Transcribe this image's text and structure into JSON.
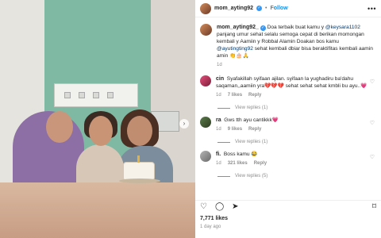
{
  "post": {
    "username": "mom_ayting92",
    "separator": "•",
    "follow_label": "Follow",
    "more_label": "•••",
    "carousel_next": "›"
  },
  "caption": {
    "username": "mom_ayting92_",
    "text_1": "Doa terbaik buat kamu y ",
    "mention_1": "@keysara1102",
    "text_2": " panjang umur sehat selalu semoga cepat di berikan momongan kembali y Aamiin y Robbal Alamin Doakan bos kamu ",
    "mention_2": "@ayutingting92",
    "text_3": " sehat kembali dbiar bisa beraktifitas kembali aamin amin 👏🎂🙏",
    "time": "1d"
  },
  "comments": [
    {
      "user": "cin",
      "text": "Syafakillah syifaan ajilan. syifaan la yughadiru ba'dahu saqaman,,aamiin yra💔💔💔 sehat sehat sehat kmbli bu ayu..💗",
      "time": "1d",
      "likes": "7 likes",
      "reply": "Reply",
      "view_replies": "View replies (1)"
    },
    {
      "user": "ra",
      "text": "Gws tth ayu cantikkk💗",
      "time": "1d",
      "likes": "9 likes",
      "reply": "Reply",
      "view_replies": "View replies (1)"
    },
    {
      "user": "fi.",
      "text": "Boss kamu 😂",
      "time": "1d",
      "likes": "321 likes",
      "reply": "Reply",
      "view_replies": "View replies (5)"
    }
  ],
  "icons": {
    "heart": "♡",
    "comment": "◯",
    "share": "➤",
    "bookmark": "⌑"
  },
  "footer": {
    "likes": "7,771 likes",
    "time_ago": "1 day ago"
  },
  "colors": {
    "link": "#0095f6",
    "mention": "#00376b",
    "verified": "#3897f0",
    "muted": "#8e8e8e"
  }
}
